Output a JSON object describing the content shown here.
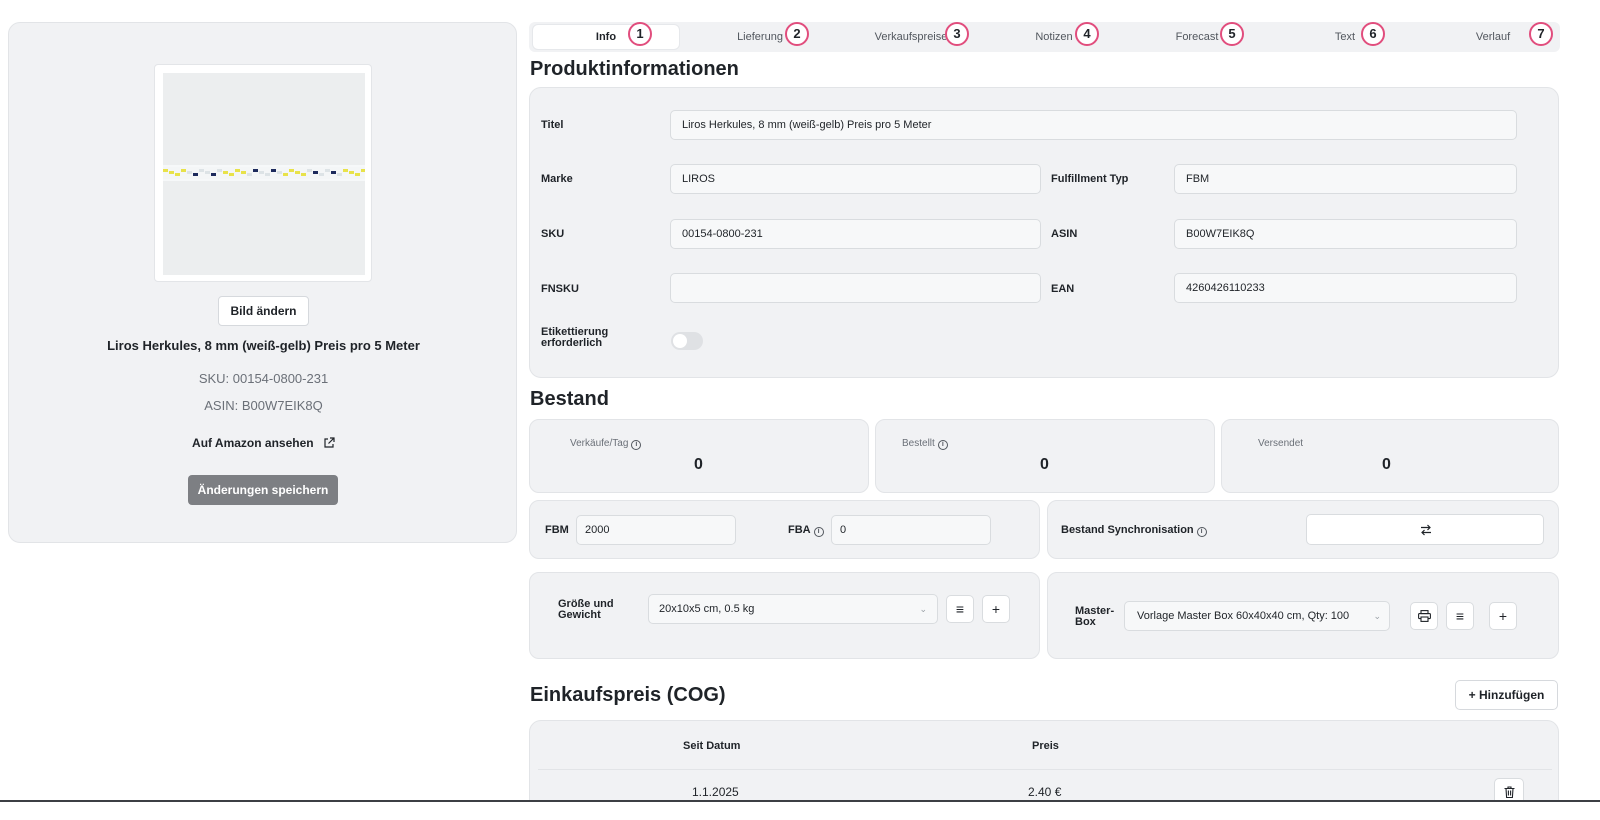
{
  "product_panel": {
    "change_image_label": "Bild ändern",
    "title": "Liros Herkules, 8 mm (weiß-gelb) Preis pro 5 Meter",
    "sku_line": "SKU: 00154-0800-231",
    "asin_line": "ASIN: B00W7EIK8Q",
    "amazon_link_label": "Auf Amazon ansehen",
    "save_label": "Änderungen speichern"
  },
  "tabs": [
    {
      "label": "Info",
      "badge": "1",
      "active": true
    },
    {
      "label": "Lieferung",
      "badge": "2"
    },
    {
      "label": "Verkaufspreise",
      "badge": "3"
    },
    {
      "label": "Notizen",
      "badge": "4"
    },
    {
      "label": "Forecast",
      "badge": "5"
    },
    {
      "label": "Text",
      "badge": "6"
    },
    {
      "label": "Verlauf",
      "badge": "7"
    }
  ],
  "product_info": {
    "heading": "Produktinformationen",
    "title_label": "Titel",
    "title_value": "Liros Herkules, 8 mm (weiß-gelb) Preis pro 5 Meter",
    "brand_label": "Marke",
    "brand_value": "LIROS",
    "fulfillment_label": "Fulfillment Typ",
    "fulfillment_value": "FBM",
    "sku_label": "SKU",
    "sku_value": "00154-0800-231",
    "asin_label": "ASIN",
    "asin_value": "B00W7EIK8Q",
    "fnsku_label": "FNSKU",
    "fnsku_value": "",
    "ean_label": "EAN",
    "ean_value": "4260426110233",
    "labeling_label_line1": "Etikettierung",
    "labeling_label_line2": "erforderlich",
    "labeling_required": false
  },
  "stock": {
    "heading": "Bestand",
    "sales_per_day_label": "Verkäufe/Tag",
    "sales_per_day_value": "0",
    "ordered_label": "Bestellt",
    "ordered_value": "0",
    "shipped_label": "Versendet",
    "shipped_value": "0",
    "fbm_label": "FBM",
    "fbm_value": "2000",
    "fba_label": "FBA",
    "fba_value": "0",
    "sync_label": "Bestand Synchronisation",
    "sync_icon": "swap-arrows-icon",
    "size_label_line1": "Größe und",
    "size_label_line2": "Gewicht",
    "size_value": "20x10x5 cm, 0.5 kg",
    "masterbox_label_line1": "Master-",
    "masterbox_label_line2": "Box",
    "masterbox_value": "Vorlage Master Box 60x40x40 cm, Qty: 100"
  },
  "cog": {
    "heading": "Einkaufspreis (COG)",
    "add_label": "Hinzufügen",
    "columns": [
      "Seit Datum",
      "Preis"
    ],
    "rows": [
      {
        "date": "1.1.2025",
        "price": "2.40 €"
      }
    ]
  },
  "colors": {
    "badge_border": "#e14d7d",
    "card_bg": "#f1f2f4",
    "save_button": "#7d7f83",
    "rope_yellow": "#e8e24a",
    "rope_navy": "#1d2a5c"
  }
}
